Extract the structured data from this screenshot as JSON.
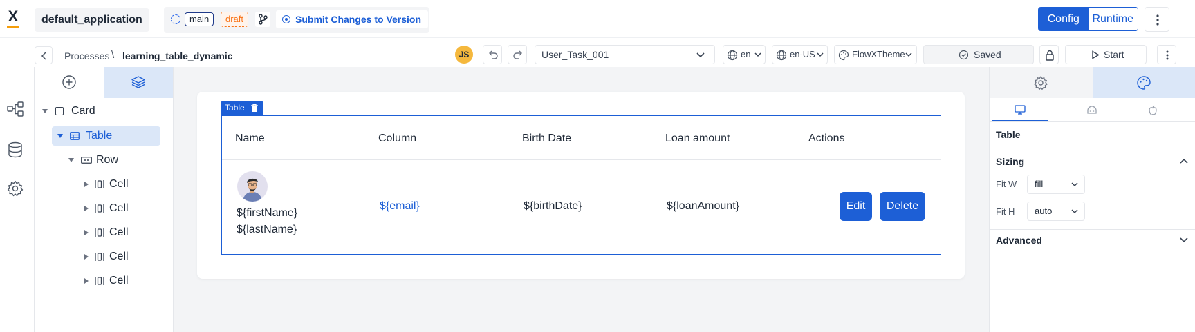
{
  "topbar": {
    "logo_text": "X",
    "app_name": "default_application",
    "branch_tag": "main",
    "status_tag": "draft",
    "submit_label": "Submit Changes to Version",
    "mode_config": "Config",
    "mode_runtime": "Runtime"
  },
  "subbar": {
    "breadcrumb_parent": "Processes",
    "breadcrumb_separator": "\\",
    "breadcrumb_current": "learning_table_dynamic",
    "user_initials": "JS",
    "node_select": "User_Task_001",
    "language": "en",
    "locale": "en-US",
    "theme": "FlowXTheme",
    "save_status": "Saved",
    "start_label": "Start"
  },
  "tree": {
    "nodes": [
      {
        "label": "Card"
      },
      {
        "label": "Table"
      },
      {
        "label": "Row"
      },
      {
        "label": "Cell"
      },
      {
        "label": "Cell"
      },
      {
        "label": "Cell"
      },
      {
        "label": "Cell"
      },
      {
        "label": "Cell"
      }
    ]
  },
  "canvas": {
    "table_tag": "Table",
    "columns": [
      "Name",
      "Column",
      "Birth Date",
      "Loan amount",
      "Actions"
    ],
    "row": {
      "first_name": "${firstName}",
      "last_name": "${lastName}",
      "email": "${email}",
      "birth_date": "${birthDate}",
      "loan_amount": "${loanAmount}",
      "edit_label": "Edit",
      "delete_label": "Delete"
    }
  },
  "rpanel": {
    "component_title": "Table",
    "sizing_title": "Sizing",
    "fit_w_label": "Fit W",
    "fit_w_value": "fill",
    "fit_h_label": "Fit H",
    "fit_h_value": "auto",
    "advanced_title": "Advanced"
  },
  "colors": {
    "accent": "#1d5fd6",
    "draft": "#f97316",
    "avatar": "#f5b83d",
    "active_tab": "#dbe7f8"
  }
}
